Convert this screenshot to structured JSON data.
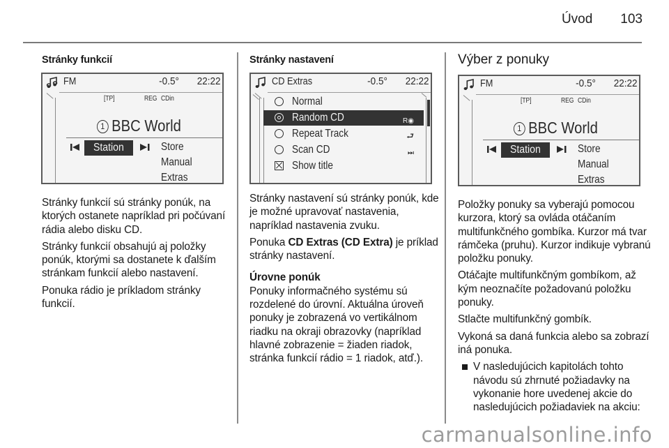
{
  "running_head": {
    "section": "Úvod",
    "page_number": "103"
  },
  "left_column": {
    "subheading": "Stránky funkcií",
    "screen": {
      "source": "FM",
      "temperature": "-0.5°",
      "time": "22:22",
      "status_tp": "[TP]",
      "status_reg": "REG",
      "status_cdin": "CDin",
      "preset_number": "1",
      "station_name": "BBC World",
      "selected_button": "Station",
      "menu_items": [
        "Store",
        "Manual",
        "Extras"
      ]
    },
    "paragraphs": [
      "Stránky funkcií sú stránky ponúk, na ktorých ostanete napríklad pri počúvaní rádia alebo disku CD.",
      "Stránky funkcií obsahujú aj položky ponúk, ktorými sa dostanete k ďalším stránkam funkcií alebo nastavení.",
      "Ponuka rádio je príkladom stránky funkcií."
    ]
  },
  "middle_column": {
    "subheading": "Stránky nastavení",
    "screen": {
      "title": "CD Extras",
      "temperature": "-0.5°",
      "time": "22:22",
      "options": [
        {
          "label": "Normal",
          "type": "radio",
          "selected": false,
          "icon": ""
        },
        {
          "label": "Random CD",
          "type": "radio",
          "selected": true,
          "icon": "random-cd-icon"
        },
        {
          "label": "Repeat Track",
          "type": "radio",
          "selected": false,
          "icon": "repeat-icon"
        },
        {
          "label": "Scan CD",
          "type": "radio",
          "selected": false,
          "icon": "scan-icon"
        },
        {
          "label": "Show title",
          "type": "checkbox",
          "checked": true,
          "icon": ""
        }
      ],
      "icon_glyphs": {
        "random": "R◉",
        "repeat": "⮐",
        "scan": "⏭"
      }
    },
    "para1": "Stránky nastavení sú stránky ponúk, kde je možné upravovať nastavenia, napríklad nastavenia zvuku.",
    "para2_prefix": "Ponuka ",
    "para2_bold": "CD Extras (CD Extra)",
    "para2_suffix": " je príklad stránky nastavení.",
    "subsection_title": "Úrovne ponúk",
    "para3": "Ponuky informačného systému sú rozdelené do úrovní. Aktuálna úroveň ponuky je zobrazená vo vertikálnom riadku na okraji obrazovky (napríklad hlavné zobrazenie = žiaden riadok, stránka funkcií rádio = 1 riadok, atď.)."
  },
  "right_column": {
    "title": "Výber z ponuky",
    "screen": {
      "source": "FM",
      "temperature": "-0.5°",
      "time": "22:22",
      "status_tp": "[TP]",
      "status_reg": "REG",
      "status_cdin": "CDin",
      "preset_number": "1",
      "station_name": "BBC World",
      "selected_button": "Station",
      "menu_items": [
        "Store",
        "Manual",
        "Extras"
      ]
    },
    "paragraphs": [
      "Položky ponuky sa vyberajú pomocou kurzora, ktorý sa ovláda otáčaním multifunkčného gombíka. Kurzor má tvar rámčeka (pruhu). Kurzor indikuje vybranú položku ponuky.",
      "Otáčajte multifunkčným gombíkom, až kým neoznačíte požadovanú položku ponuky.",
      "Stlačte multifunkčný gombík.",
      "Vykoná sa daná funkcia alebo sa zobrazí iná ponuka."
    ],
    "bullet": "V nasledujúcich kapitolách tohto návodu sú zhrnuté požiadavky na vykonanie hore uvedenej akcie do nasledujúcich požiadaviek na akciu:"
  },
  "watermark": "carmanualsonline.info"
}
